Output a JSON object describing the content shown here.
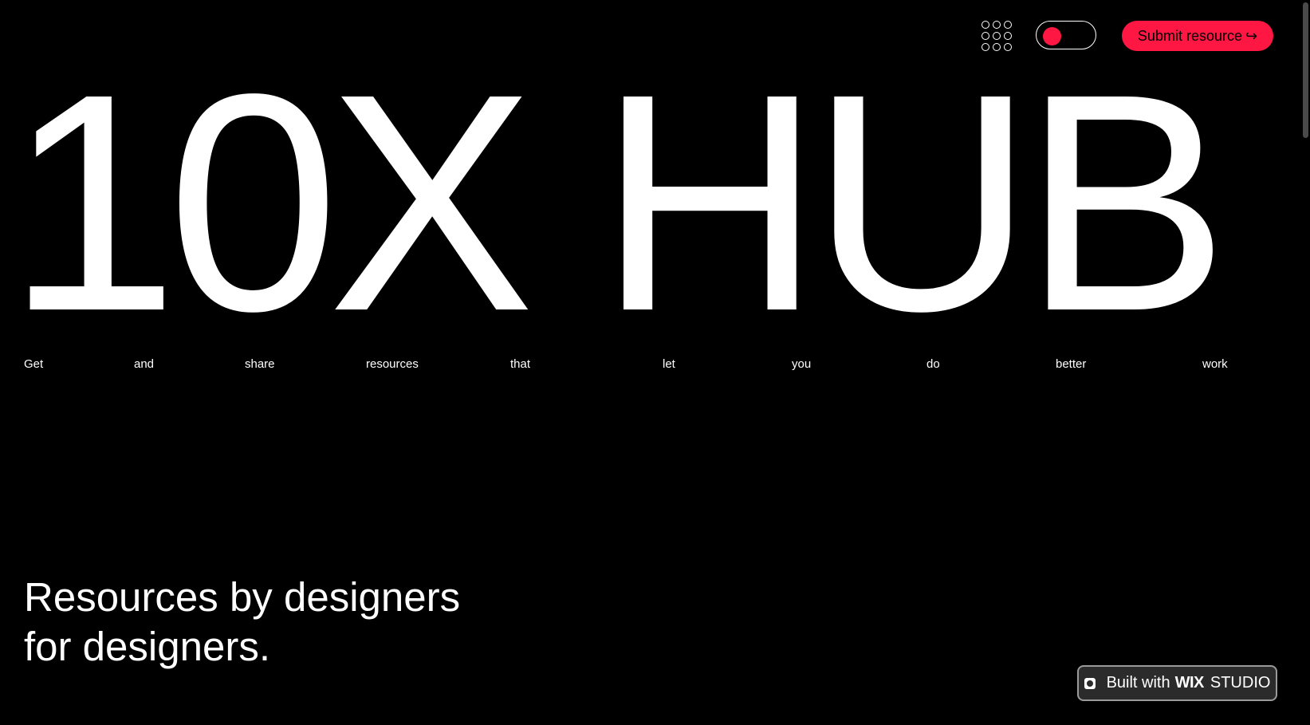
{
  "header": {
    "menu_icon": "grid-menu-icon",
    "theme_toggle_icon": "toggle-icon",
    "submit_label": "Submit resource",
    "submit_arrow": "↪",
    "accent_color": "#ff1744"
  },
  "hero": {
    "title": "10X HUB",
    "tagline_words": [
      "Get",
      "and",
      "share",
      "resources",
      "that",
      "let",
      "you",
      "do",
      "better",
      "work"
    ]
  },
  "subheading": {
    "line1": "Resources by designers",
    "line2": "for designers."
  },
  "badge": {
    "prefix": "Built with",
    "brand_bold": "WIX",
    "brand_light": "STUDIO"
  }
}
